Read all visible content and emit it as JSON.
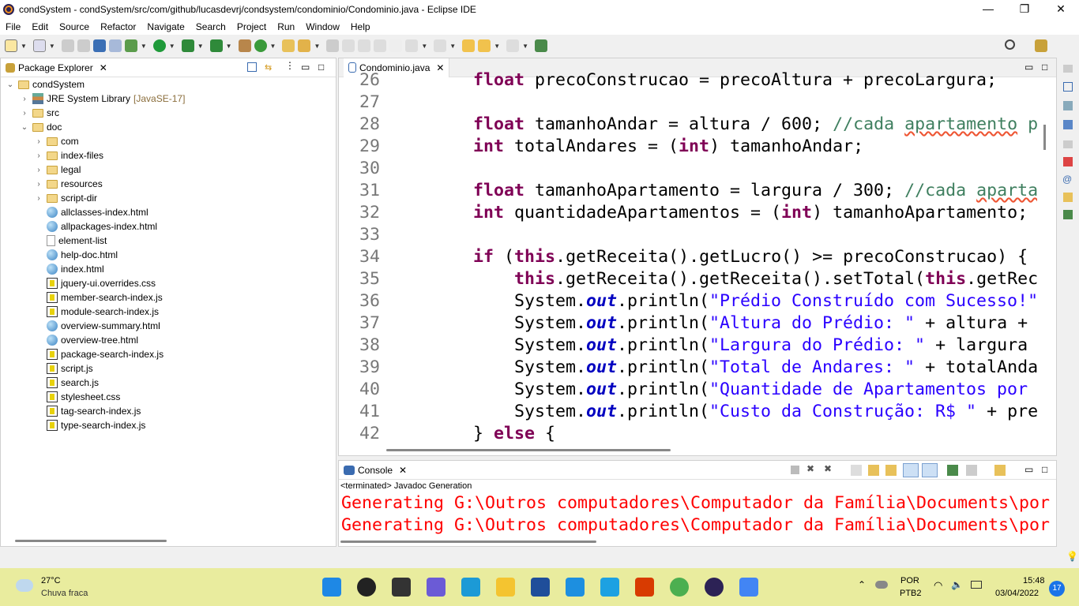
{
  "window": {
    "title": "condSystem - condSystem/src/com/github/lucasdevrj/condsystem/condominio/Condominio.java - Eclipse IDE",
    "minimize": "—",
    "maximize": "❐",
    "close": "✕"
  },
  "menu": [
    "File",
    "Edit",
    "Source",
    "Refactor",
    "Navigate",
    "Search",
    "Project",
    "Run",
    "Window",
    "Help"
  ],
  "package_explorer": {
    "title": "Package Explorer",
    "tree": [
      {
        "label": "condSystem",
        "depth": 0,
        "twisty": "v",
        "icon": "project"
      },
      {
        "label": "JRE System Library",
        "deco": "[JavaSE-17]",
        "depth": 1,
        "twisty": ">",
        "icon": "library"
      },
      {
        "label": "src",
        "depth": 1,
        "twisty": ">",
        "icon": "source-folder"
      },
      {
        "label": "doc",
        "depth": 1,
        "twisty": "v",
        "icon": "folder"
      },
      {
        "label": "com",
        "depth": 2,
        "twisty": ">",
        "icon": "folder"
      },
      {
        "label": "index-files",
        "depth": 2,
        "twisty": ">",
        "icon": "folder"
      },
      {
        "label": "legal",
        "depth": 2,
        "twisty": ">",
        "icon": "folder"
      },
      {
        "label": "resources",
        "depth": 2,
        "twisty": ">",
        "icon": "folder"
      },
      {
        "label": "script-dir",
        "depth": 2,
        "twisty": ">",
        "icon": "folder"
      },
      {
        "label": "allclasses-index.html",
        "depth": 2,
        "icon": "html"
      },
      {
        "label": "allpackages-index.html",
        "depth": 2,
        "icon": "html"
      },
      {
        "label": "element-list",
        "depth": 2,
        "icon": "file"
      },
      {
        "label": "help-doc.html",
        "depth": 2,
        "icon": "html"
      },
      {
        "label": "index.html",
        "depth": 2,
        "icon": "html"
      },
      {
        "label": "jquery-ui.overrides.css",
        "depth": 2,
        "icon": "css"
      },
      {
        "label": "member-search-index.js",
        "depth": 2,
        "icon": "js"
      },
      {
        "label": "module-search-index.js",
        "depth": 2,
        "icon": "js"
      },
      {
        "label": "overview-summary.html",
        "depth": 2,
        "icon": "html"
      },
      {
        "label": "overview-tree.html",
        "depth": 2,
        "icon": "html"
      },
      {
        "label": "package-search-index.js",
        "depth": 2,
        "icon": "js"
      },
      {
        "label": "script.js",
        "depth": 2,
        "icon": "js"
      },
      {
        "label": "search.js",
        "depth": 2,
        "icon": "js"
      },
      {
        "label": "stylesheet.css",
        "depth": 2,
        "icon": "css"
      },
      {
        "label": "tag-search-index.js",
        "depth": 2,
        "icon": "js"
      },
      {
        "label": "type-search-index.js",
        "depth": 2,
        "icon": "js"
      }
    ]
  },
  "editor": {
    "tab": "Condominio.java",
    "lines": [
      {
        "n": "26",
        "t": [
          [
            "p",
            "        "
          ],
          [
            "kw",
            "float"
          ],
          [
            "p",
            " precoConstrucao = precoAltura + precoLargura;"
          ]
        ]
      },
      {
        "n": "27",
        "t": []
      },
      {
        "n": "28",
        "t": [
          [
            "p",
            "        "
          ],
          [
            "kw",
            "float"
          ],
          [
            "p",
            " tamanhoAndar = altura / 600; "
          ],
          [
            "cm",
            "//cada "
          ],
          [
            "cmsq",
            "apartamento"
          ],
          [
            "cm",
            " p"
          ]
        ]
      },
      {
        "n": "29",
        "t": [
          [
            "p",
            "        "
          ],
          [
            "kw",
            "int"
          ],
          [
            "p",
            " totalAndares = ("
          ],
          [
            "kw",
            "int"
          ],
          [
            "p",
            ") tamanhoAndar;"
          ]
        ]
      },
      {
        "n": "30",
        "t": []
      },
      {
        "n": "31",
        "t": [
          [
            "p",
            "        "
          ],
          [
            "kw",
            "float"
          ],
          [
            "p",
            " tamanhoApartamento = largura / 300; "
          ],
          [
            "cm",
            "//cada "
          ],
          [
            "cmsq",
            "aparta"
          ]
        ]
      },
      {
        "n": "32",
        "t": [
          [
            "p",
            "        "
          ],
          [
            "kw",
            "int"
          ],
          [
            "p",
            " quantidadeApartamentos = ("
          ],
          [
            "kw",
            "int"
          ],
          [
            "p",
            ") tamanhoApartamento;"
          ]
        ]
      },
      {
        "n": "33",
        "t": []
      },
      {
        "n": "34",
        "t": [
          [
            "p",
            "        "
          ],
          [
            "kw",
            "if"
          ],
          [
            "p",
            " ("
          ],
          [
            "kw",
            "this"
          ],
          [
            "p",
            ".getReceita().getLucro() >= precoConstrucao) {"
          ]
        ]
      },
      {
        "n": "35",
        "t": [
          [
            "p",
            "            "
          ],
          [
            "kw",
            "this"
          ],
          [
            "p",
            ".getReceita().getReceita().setTotal("
          ],
          [
            "kw",
            "this"
          ],
          [
            "p",
            ".getRec"
          ]
        ]
      },
      {
        "n": "36",
        "t": [
          [
            "p",
            "            System."
          ],
          [
            "fld",
            "out"
          ],
          [
            "p",
            ".println("
          ],
          [
            "str",
            "\"Prédio Construído com Sucesso!\""
          ]
        ]
      },
      {
        "n": "37",
        "t": [
          [
            "p",
            "            System."
          ],
          [
            "fld",
            "out"
          ],
          [
            "p",
            ".println("
          ],
          [
            "str",
            "\"Altura do Prédio: \""
          ],
          [
            "p",
            " + altura +"
          ]
        ]
      },
      {
        "n": "38",
        "t": [
          [
            "p",
            "            System."
          ],
          [
            "fld",
            "out"
          ],
          [
            "p",
            ".println("
          ],
          [
            "str",
            "\"Largura do Prédio: \""
          ],
          [
            "p",
            " + largura"
          ]
        ]
      },
      {
        "n": "39",
        "t": [
          [
            "p",
            "            System."
          ],
          [
            "fld",
            "out"
          ],
          [
            "p",
            ".println("
          ],
          [
            "str",
            "\"Total de Andares: \""
          ],
          [
            "p",
            " + totalAnda"
          ]
        ]
      },
      {
        "n": "40",
        "t": [
          [
            "p",
            "            System."
          ],
          [
            "fld",
            "out"
          ],
          [
            "p",
            ".println("
          ],
          [
            "str",
            "\"Quantidade de Apartamentos por"
          ]
        ]
      },
      {
        "n": "41",
        "t": [
          [
            "p",
            "            System."
          ],
          [
            "fld",
            "out"
          ],
          [
            "p",
            ".println("
          ],
          [
            "str",
            "\"Custo da Construção: R$ \""
          ],
          [
            "p",
            " + pre"
          ]
        ]
      },
      {
        "n": "42",
        "t": [
          [
            "p",
            "        } "
          ],
          [
            "kw",
            "else"
          ],
          [
            "p",
            " {"
          ]
        ]
      }
    ]
  },
  "console": {
    "title": "Console",
    "status": "<terminated> Javadoc Generation",
    "lines": [
      "Generating G:\\Outros computadores\\Computador da Família\\Documents\\por",
      "Generating G:\\Outros computadores\\Computador da Família\\Documents\\por"
    ]
  },
  "taskbar": {
    "weather_temp": "27°C",
    "weather_desc": "Chuva fraca",
    "lang": "POR",
    "layout": "PTB2",
    "time": "15:48",
    "date": "03/04/2022",
    "notifications": "17",
    "apps": [
      {
        "name": "start",
        "color": "#1e88e5"
      },
      {
        "name": "search",
        "color": "#222"
      },
      {
        "name": "task-view",
        "color": "#333"
      },
      {
        "name": "teams-chat",
        "color": "#6b5bd6"
      },
      {
        "name": "edge",
        "color": "#1c9ad6"
      },
      {
        "name": "file-explorer",
        "color": "#f4c430"
      },
      {
        "name": "store",
        "color": "#1f4e9a"
      },
      {
        "name": "mail",
        "color": "#1d8fe0"
      },
      {
        "name": "app-l",
        "color": "#1da1e2"
      },
      {
        "name": "office",
        "color": "#d83b01"
      },
      {
        "name": "chrome",
        "color": "#4caf50"
      },
      {
        "name": "eclipse",
        "color": "#2c2255"
      },
      {
        "name": "app-diamond",
        "color": "#4285f4"
      }
    ]
  },
  "colors": {
    "keyword": "#7f0055",
    "string": "#2a00ff",
    "comment": "#3f7f5f",
    "field": "#0000c0",
    "console_error": "#ff0000"
  }
}
